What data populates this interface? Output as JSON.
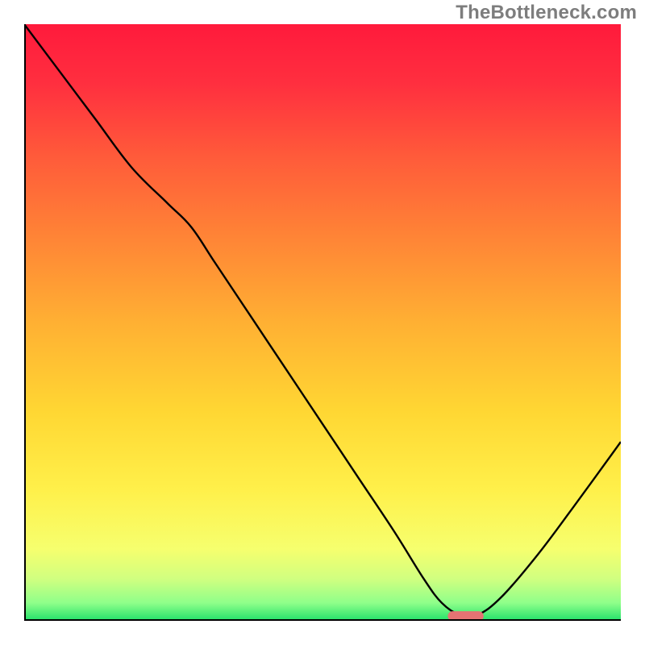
{
  "watermark": "TheBottleneck.com",
  "chart_data": {
    "type": "line",
    "title": "",
    "xlabel": "",
    "ylabel": "",
    "xlim": [
      0,
      100
    ],
    "ylim": [
      0,
      100
    ],
    "grid": false,
    "series": [
      {
        "name": "bottleneck-curve",
        "x": [
          0,
          6,
          12,
          18,
          24,
          28,
          32,
          38,
          44,
          50,
          56,
          62,
          67,
          70,
          73,
          76,
          80,
          86,
          92,
          100
        ],
        "y": [
          100,
          92,
          84,
          76,
          70,
          66,
          60,
          51,
          42,
          33,
          24,
          15,
          7,
          3,
          1,
          1,
          4,
          11,
          19,
          30
        ]
      }
    ],
    "optimal_marker": {
      "x_start": 71,
      "x_end": 77,
      "y": 0.8
    },
    "background_gradient": {
      "stops": [
        {
          "offset": 0.0,
          "color": "#ff1a3c"
        },
        {
          "offset": 0.1,
          "color": "#ff2f3f"
        },
        {
          "offset": 0.22,
          "color": "#ff5a3a"
        },
        {
          "offset": 0.35,
          "color": "#ff8236"
        },
        {
          "offset": 0.5,
          "color": "#ffb033"
        },
        {
          "offset": 0.65,
          "color": "#ffd733"
        },
        {
          "offset": 0.78,
          "color": "#fff04a"
        },
        {
          "offset": 0.88,
          "color": "#f6ff6e"
        },
        {
          "offset": 0.93,
          "color": "#d0ff80"
        },
        {
          "offset": 0.97,
          "color": "#8fff8a"
        },
        {
          "offset": 1.0,
          "color": "#22e06a"
        }
      ]
    },
    "axis_color": "#000000",
    "curve_color": "#000000",
    "marker_color": "#e57373"
  }
}
